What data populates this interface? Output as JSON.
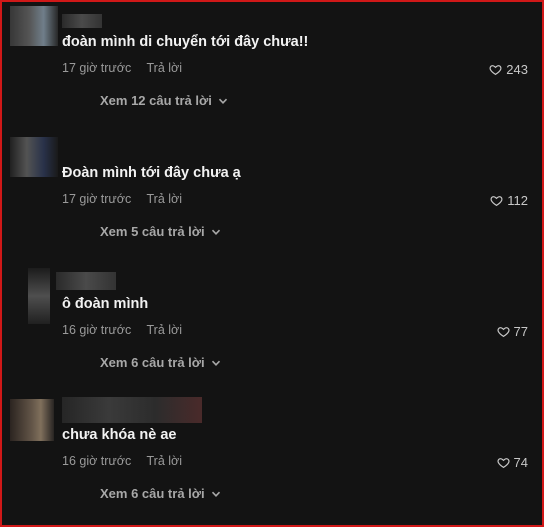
{
  "comments": [
    {
      "text": "đoàn mình di chuyển tới đây chưa!!",
      "time": "17 giờ trước",
      "reply": "Trả lời",
      "likes": "243",
      "view_replies": "Xem 12 câu trả lời"
    },
    {
      "text": "Đoàn mình tới đây chưa ạ",
      "time": "17 giờ trước",
      "reply": "Trả lời",
      "likes": "112",
      "view_replies": "Xem 5 câu trả lời"
    },
    {
      "text": "ô đoàn mình",
      "time": "16 giờ trước",
      "reply": "Trả lời",
      "likes": "77",
      "view_replies": "Xem 6 câu trả lời"
    },
    {
      "text": "chưa khóa nè ae",
      "time": "16 giờ trước",
      "reply": "Trả lời",
      "likes": "74",
      "view_replies": "Xem 6 câu trả lời"
    }
  ],
  "colors": {
    "background": "#131313",
    "border": "#d01818",
    "text": "#f2f2f2",
    "muted": "#9a9a9a"
  },
  "icons": {
    "like": "heart-outline-icon",
    "expand": "chevron-down-icon"
  }
}
